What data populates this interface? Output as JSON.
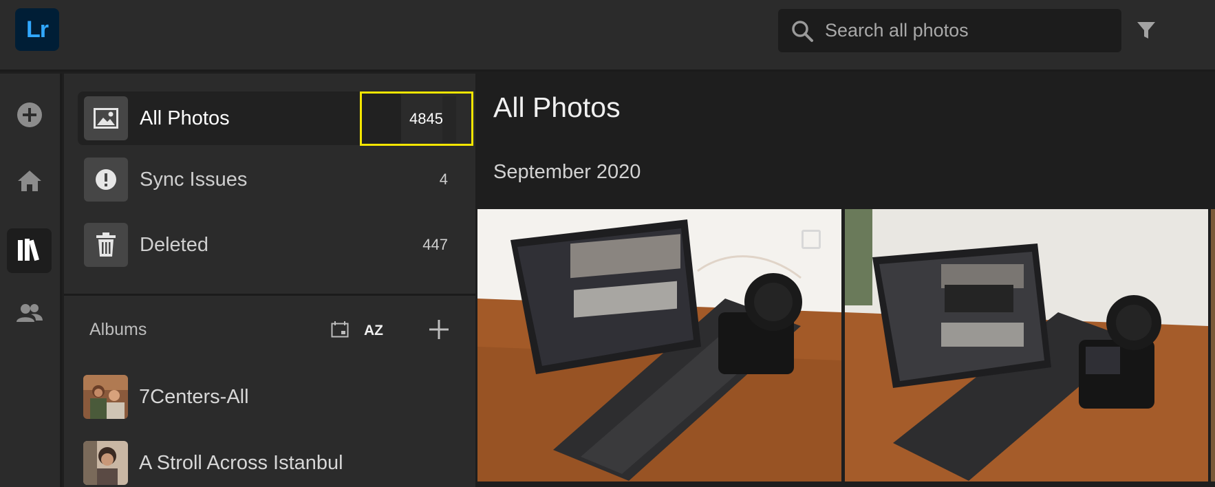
{
  "app": {
    "logo_text": "Lr",
    "accent": "#31a8ff",
    "logo_bg": "#001e36"
  },
  "search": {
    "placeholder": "Search all photos",
    "value": ""
  },
  "rail": {
    "items": [
      {
        "icon": "add-icon"
      },
      {
        "icon": "home-icon"
      },
      {
        "icon": "library-icon",
        "active": true
      },
      {
        "icon": "people-icon"
      }
    ]
  },
  "sources": {
    "items": [
      {
        "label": "All Photos",
        "count": "4845",
        "icon": "photo-icon",
        "selected": true
      },
      {
        "label": "Sync Issues",
        "count": "4",
        "icon": "alert-icon"
      },
      {
        "label": "Deleted",
        "count": "447",
        "icon": "trash-icon"
      }
    ]
  },
  "albums": {
    "title": "Albums",
    "sort_alpha_label": "AZ",
    "items": [
      {
        "label": "7Centers-All"
      },
      {
        "label": "A Stroll Across Istanbul"
      }
    ]
  },
  "main": {
    "title": "All Photos",
    "section": "September 2020"
  },
  "highlight_color": "#f5e600"
}
